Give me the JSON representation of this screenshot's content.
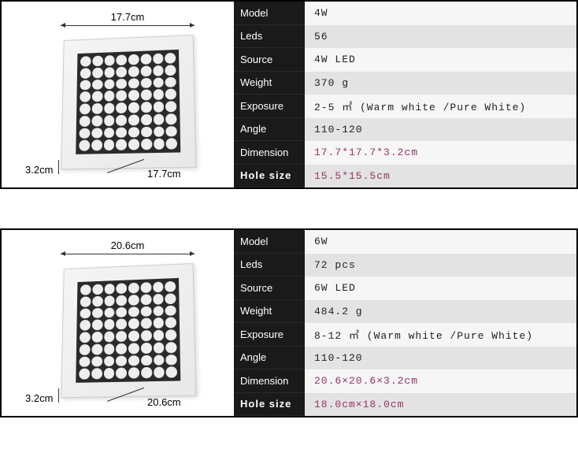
{
  "products": [
    {
      "dims": {
        "top": "17.7cm",
        "bottom": "17.7cm",
        "depth": "3.2cm"
      },
      "labels": {
        "model": "Model",
        "leds": "Leds",
        "source": "Source",
        "weight": "Weight",
        "exposure": "Exposure",
        "angle": "Angle",
        "dimension": "Dimension",
        "hole": "Hole size"
      },
      "values": {
        "model": "4W",
        "leds": "56",
        "source": "4W LED",
        "weight": "370 g",
        "exposure": "2-5 ㎡  (Warm white /Pure White)",
        "angle": "110-120",
        "dimension": "17.7*17.7*3.2cm",
        "hole": "15.5*15.5cm"
      }
    },
    {
      "dims": {
        "top": "20.6cm",
        "bottom": "20.6cm",
        "depth": "3.2cm"
      },
      "labels": {
        "model": "Model",
        "leds": "Leds",
        "source": "Source",
        "weight": "Weight",
        "exposure": "Exposure",
        "angle": "Angle",
        "dimension": "Dimension",
        "hole": "Hole size"
      },
      "values": {
        "model": "6W",
        "leds": "72 pcs",
        "source": "6W LED",
        "weight": "484.2 g",
        "exposure": "8-12 ㎡  (Warm white /Pure White)",
        "angle": "110-120",
        "dimension": "20.6×20.6×3.2cm",
        "hole": "18.0cm×18.0cm"
      }
    }
  ]
}
